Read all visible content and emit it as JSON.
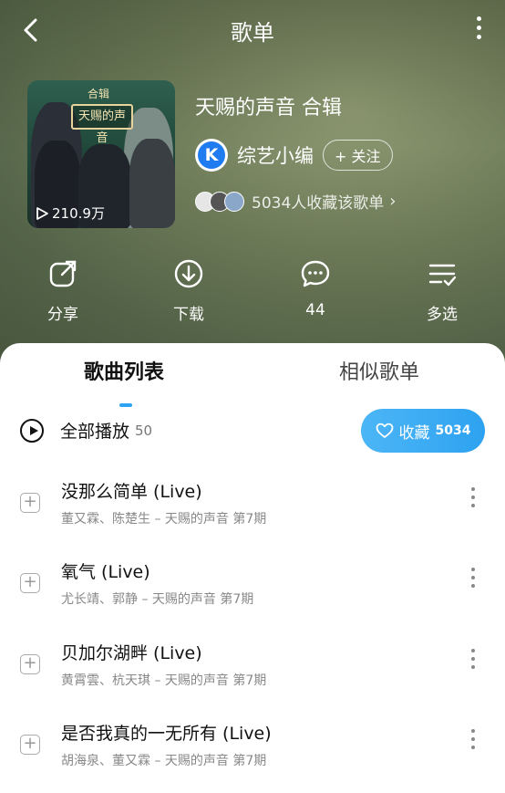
{
  "header": {
    "title": "歌单"
  },
  "playlist": {
    "cover_badge": "合辑",
    "cover_logo_text": "天赐的声音",
    "play_count": "210.9万",
    "title": "天赐的声音 合辑",
    "author_avatar_letter": "K",
    "author_name": "综艺小编",
    "follow_label": "+ 关注",
    "collectors_text": "5034人收藏该歌单"
  },
  "actions": [
    {
      "label": "分享",
      "icon": "share-icon"
    },
    {
      "label": "下载",
      "icon": "download-icon"
    },
    {
      "label": "44",
      "icon": "comment-icon"
    },
    {
      "label": "多选",
      "icon": "multi-select-icon"
    }
  ],
  "tabs": [
    {
      "label": "歌曲列表",
      "active": true
    },
    {
      "label": "相似歌单",
      "active": false
    }
  ],
  "play_all": {
    "label": "全部播放",
    "count": "50"
  },
  "collect_button": {
    "label": "收藏",
    "count": "5034"
  },
  "songs": [
    {
      "title": "没那么简单 (Live)",
      "subtitle": "董又霖、陈楚生 – 天赐的声音 第7期"
    },
    {
      "title": "氧气 (Live)",
      "subtitle": "尤长靖、郭静 – 天赐的声音 第7期"
    },
    {
      "title": "贝加尔湖畔 (Live)",
      "subtitle": "黄霄雲、杭天琪 – 天赐的声音 第7期"
    },
    {
      "title": "是否我真的一无所有 (Live)",
      "subtitle": "胡海泉、董又霖 – 天赐的声音 第7期"
    }
  ],
  "colors": {
    "accent": "#2ea3f2",
    "author_blue": "#1e7bf0",
    "hero_green": "#6f7d5e"
  }
}
